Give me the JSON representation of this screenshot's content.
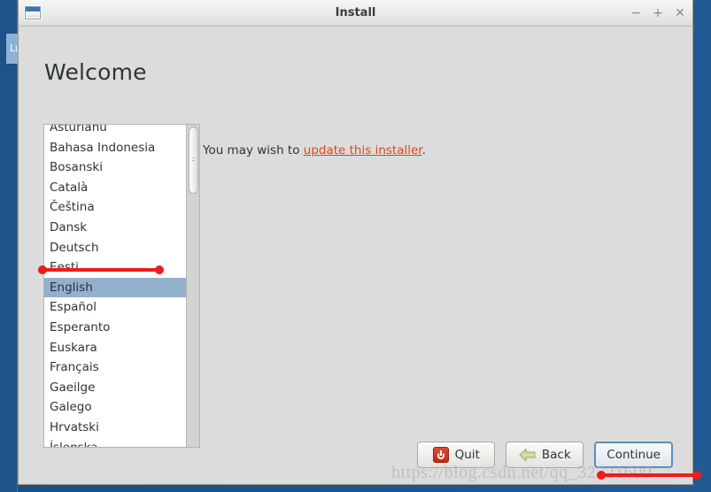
{
  "desktop": {
    "dock_item_label": "Lu"
  },
  "window": {
    "title": "Install",
    "icon": "application-window-icon",
    "controls": {
      "minimize": "−",
      "maximize": "+",
      "close": "✕"
    }
  },
  "page": {
    "heading": "Welcome"
  },
  "language_list": {
    "selected": "English",
    "items": [
      {
        "label": "Asturianu",
        "selected": false,
        "clipped": true
      },
      {
        "label": "Bahasa Indonesia",
        "selected": false
      },
      {
        "label": "Bosanski",
        "selected": false
      },
      {
        "label": "Català",
        "selected": false
      },
      {
        "label": "Čeština",
        "selected": false
      },
      {
        "label": "Dansk",
        "selected": false
      },
      {
        "label": "Deutsch",
        "selected": false
      },
      {
        "label": "Eesti",
        "selected": false
      },
      {
        "label": "English",
        "selected": true
      },
      {
        "label": "Español",
        "selected": false
      },
      {
        "label": "Esperanto",
        "selected": false
      },
      {
        "label": "Euskara",
        "selected": false
      },
      {
        "label": "Français",
        "selected": false
      },
      {
        "label": "Gaeilge",
        "selected": false
      },
      {
        "label": "Galego",
        "selected": false
      },
      {
        "label": "Hrvatski",
        "selected": false
      },
      {
        "label": "Íslenska",
        "selected": false,
        "clipped": true
      }
    ]
  },
  "main": {
    "note_prefix": "You may wish to ",
    "note_link": "update this installer",
    "note_suffix": ".",
    "link_color": "#dd4814"
  },
  "buttons": {
    "quit": {
      "label": "Quit",
      "icon": "power-icon"
    },
    "back": {
      "label": "Back",
      "icon": "left-arrow-icon"
    },
    "continue": {
      "label": "Continue",
      "focused": true
    }
  },
  "annotations": {
    "english_highlight": "red-underline-annotation",
    "bottom_highlight": "red-underline-annotation"
  },
  "watermark": {
    "text": "https://blog.csdn.net/qq_32721600"
  }
}
